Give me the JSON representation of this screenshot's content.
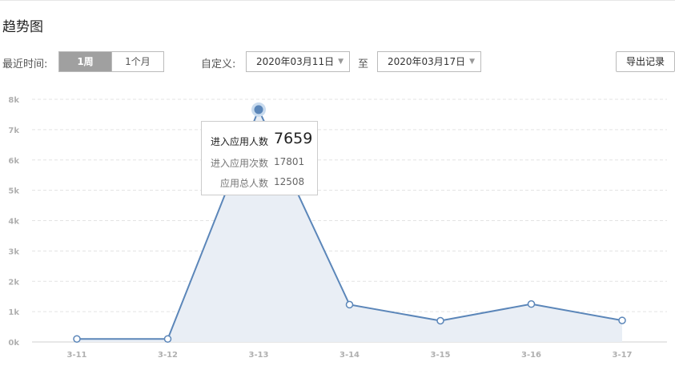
{
  "title": "趋势图",
  "toolbar": {
    "recent_label": "最近时间:",
    "range_options": [
      "1周",
      "1个月"
    ],
    "active_range": "1周",
    "custom_label": "自定义:",
    "start_date": "2020年03月11日",
    "to_label": "至",
    "end_date": "2020年03月17日",
    "export_label": "导出记录"
  },
  "chart_data": {
    "type": "area",
    "categories": [
      "3-11",
      "3-12",
      "3-13",
      "3-14",
      "3-15",
      "3-16",
      "3-17"
    ],
    "series": [
      {
        "values": [
          100,
          100,
          7659,
          1230,
          700,
          1250,
          710
        ]
      }
    ],
    "y_ticks": [
      "0k",
      "1k",
      "2k",
      "3k",
      "4k",
      "5k",
      "6k",
      "7k",
      "8k"
    ],
    "ylim": [
      0,
      8000
    ],
    "grid": true,
    "line_color": "#5b86b9",
    "fill_color": "#e9eef5",
    "highlight_category": "3-13"
  },
  "tooltip": {
    "rows": [
      {
        "label": "进入应用人数",
        "value": "7659"
      },
      {
        "label": "进入应用次数",
        "value": "17801"
      },
      {
        "label": "应用总人数",
        "value": "12508"
      }
    ]
  }
}
